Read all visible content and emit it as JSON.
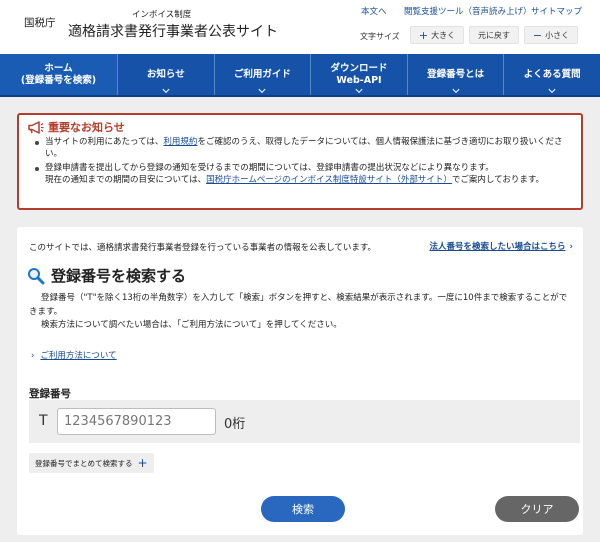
{
  "header": {
    "agency": "国税庁",
    "subtitle": "インボイス制度",
    "title": "適格請求書発行事業者公表サイト",
    "utility_links": [
      {
        "label": "本文へ"
      },
      {
        "label": "閲覧支援ツール（音声読み上げ）"
      },
      {
        "label": "サイトマップ"
      }
    ],
    "font_size": {
      "label": "文字サイズ",
      "larger": "大きく",
      "reset": "元に戻す",
      "smaller": "小さく"
    }
  },
  "nav": {
    "items": [
      {
        "line1": "ホーム",
        "line2": "(登録番号を検索)"
      },
      {
        "line1": "お知らせ",
        "line2": ""
      },
      {
        "line1": "ご利用ガイド",
        "line2": ""
      },
      {
        "line1": "ダウンロード",
        "line2": "Web-API"
      },
      {
        "line1": "登録番号とは",
        "line2": ""
      },
      {
        "line1": "よくある質問",
        "line2": ""
      }
    ]
  },
  "notice": {
    "title": "重要なお知らせ",
    "item1": {
      "pre": "当サイトの利用にあたっては、",
      "link": "利用規約",
      "post": "をご確認のうえ、取得したデータについては、個人情報保護法に基づき適切にお取り扱いください。"
    },
    "item2": {
      "line1": "登録申請書を提出してから登録の通知を受けるまでの期間については、登録申請書の提出状況などにより異なります。",
      "pre": "現在の通知までの期間の目安については、",
      "link": "国税庁ホームページのインボイス制度特設サイト（外部サイト）",
      "post": "でご案内しております。"
    }
  },
  "search": {
    "intro": "このサイトでは、適格請求書発行事業者登録を行っている事業者の情報を公表しています。",
    "corp_link": "法人番号を検索したい場合はこちら",
    "title": "登録番号を検索する",
    "desc1": "登録番号（\"T\"を除く13桁の半角数字）を入力して「検索」ボタンを押すと、検索結果が表示されます。一度に10件まで検索することができます。",
    "desc2": "検索方法について調べたい場合は、「ご利用方法について」を押してください。",
    "howto_link": "ご利用方法について",
    "field_label": "登録番号",
    "prefix": "T",
    "placeholder": "1234567890123",
    "value": "",
    "digit_count": "0桁",
    "bulk_button": "登録番号でまとめて検索する",
    "search_button": "検索",
    "clear_button": "クリア"
  },
  "colors": {
    "nav_blue": "#1653a8",
    "link_blue": "#1a4c96",
    "notice_red": "#b53d2d",
    "search_btn": "#2a67bf",
    "clear_btn": "#666666"
  }
}
